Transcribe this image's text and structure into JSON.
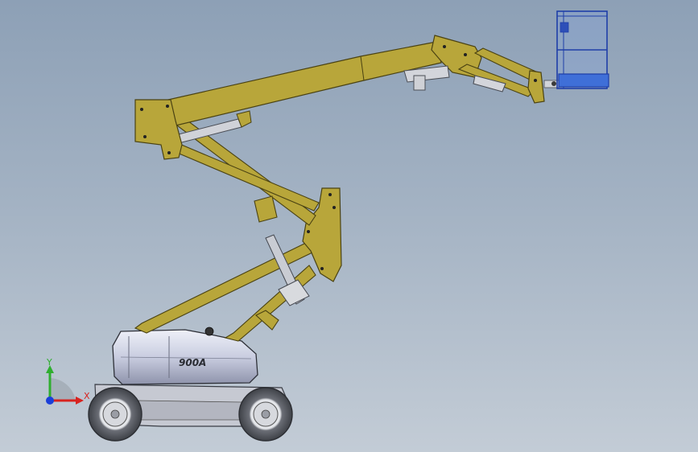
{
  "viewport": {
    "model_label": "900A",
    "triad": {
      "x_label": "X",
      "y_label": "Y"
    },
    "colors": {
      "boom": "#b8a63a",
      "boom_dark": "#7e6f1c",
      "platform": "#3f6fd8",
      "chassis_body": "#d0d4e2",
      "tire": "#5c5f66",
      "axis_x": "#d8231f",
      "axis_y": "#2fae2f",
      "axis_z": "#1b3fd9"
    }
  }
}
